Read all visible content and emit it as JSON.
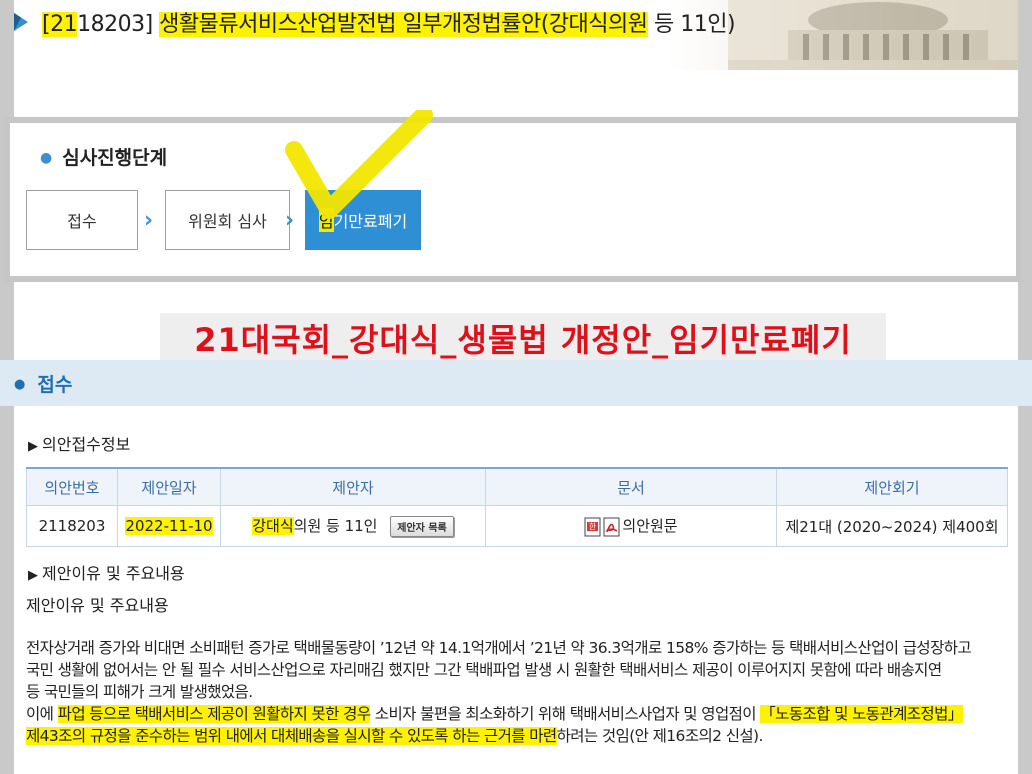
{
  "title": {
    "bill_no_prefix": "[21",
    "bill_no_rest": "18203]",
    "bill_name_hl": "생활물류서비스산업발전법 일부개정법률안",
    "proposer_hl": "(강대식의원",
    "proposer_rest": " 등 11인)"
  },
  "stages": {
    "heading": "심사진행단계",
    "steps": [
      "접수",
      "위원회 심사",
      "임기만료폐기"
    ],
    "separator": "›"
  },
  "banner": "21대국회_강대식_생물법 개정안_임기만료폐기",
  "receipt": {
    "section_title": "접수",
    "info_heading": "의안접수정보",
    "table": {
      "headers": [
        "의안번호",
        "제안일자",
        "제안자",
        "문서",
        "제안회기"
      ],
      "row": {
        "bill_no": "2118203",
        "date": "2022-11-10",
        "proposer_hl": "강대식",
        "proposer_rest": "의원 등 11인",
        "proposer_button": "제안자 목록",
        "document": "의안원문",
        "session": "제21대 (2020~2024) 제400회"
      }
    },
    "reason_heading": "제안이유 및 주요내용",
    "reason_label": "제안이유 및 주요내용",
    "body": {
      "line1": "전자상거래 증가와 비대면 소비패턴 증가로 택배물동량이 ’12년 약 14.1억개에서 ’21년 약 36.3억개로 158% 증가하는 등 택배서비스산업이 급성장하고",
      "line2": "국민 생활에 없어서는 안 될 필수 서비스산업으로 자리매김 했지만 그간 택배파업 발생 시 원활한 택배서비스 제공이 이루어지지 못함에 따라 배송지연",
      "line3": "등 국민들의 피해가 크게 발생했었음.",
      "line4_a": "이에 ",
      "line4_hl1": "파업 등으로 택배서비스 제공이 원활하지 못한 경우",
      "line4_b": " 소비자 불편을 최소화하기 위해 택배서비스사업자 및 영업점이 ",
      "line4_hl2": "「노동조합 및 노동관계조정법」",
      "line5_hl": "제43조의 규정을 준수하는 범위 내에서 대체배송을 실시할 수 있도록 하는 근거를 마련",
      "line5_rest": "하려는 것임(안 제16조의2 신설)."
    }
  },
  "colors": {
    "accent_blue": "#2f8fd4",
    "highlight": "#fff200",
    "banner_red": "#e0101a"
  }
}
